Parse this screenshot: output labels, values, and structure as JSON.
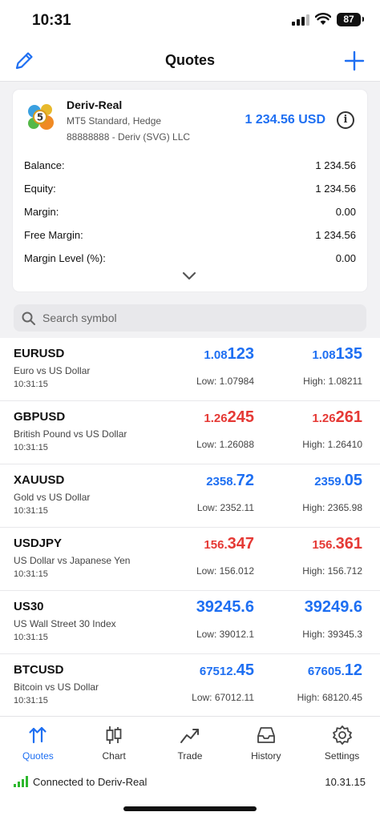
{
  "status_bar": {
    "time": "10:31",
    "battery": "87"
  },
  "nav": {
    "title": "Quotes"
  },
  "account": {
    "name": "Deriv-Real",
    "type": "MT5 Standard, Hedge",
    "login": "88888888 - Deriv (SVG) LLC",
    "balance_display": "1 234.56 USD",
    "info_glyph": "i",
    "rows": [
      {
        "label": "Balance:",
        "value": "1 234.56"
      },
      {
        "label": "Equity:",
        "value": "1 234.56"
      },
      {
        "label": "Margin:",
        "value": "0.00"
      },
      {
        "label": "Free Margin:",
        "value": "1 234.56"
      },
      {
        "label": "Margin Level (%):",
        "value": "0.00"
      }
    ]
  },
  "search": {
    "placeholder": "Search symbol"
  },
  "quotes": [
    {
      "symbol": "EURUSD",
      "desc": "Euro vs US Dollar",
      "time": "10:31:15",
      "bid_small": "1.08",
      "bid_big": "123",
      "ask_small": "1.08",
      "ask_big": "135",
      "direction": "up",
      "low": "Low: 1.07984",
      "high": "High: 1.08211"
    },
    {
      "symbol": "GBPUSD",
      "desc": "British Pound vs US Dollar",
      "time": "10:31:15",
      "bid_small": "1.26",
      "bid_big": "245",
      "ask_small": "1.26",
      "ask_big": "261",
      "direction": "down",
      "low": "Low: 1.26088",
      "high": "High: 1.26410"
    },
    {
      "symbol": "XAUUSD",
      "desc": "Gold vs US Dollar",
      "time": "10:31:15",
      "bid_small": "2358.",
      "bid_big": "72",
      "ask_small": "2359.",
      "ask_big": "05",
      "direction": "up",
      "low": "Low: 2352.11",
      "high": "High: 2365.98"
    },
    {
      "symbol": "USDJPY",
      "desc": "US Dollar vs Japanese Yen",
      "time": "10:31:15",
      "bid_small": "156.",
      "bid_big": "347",
      "ask_small": "156.",
      "ask_big": "361",
      "direction": "down",
      "low": "Low: 156.012",
      "high": "High: 156.712"
    },
    {
      "symbol": "US30",
      "desc": "US Wall Street 30 Index",
      "time": "10:31:15",
      "bid_small": "3924",
      "bid_big": "5.6",
      "ask_small": "3924",
      "ask_big": "9.6",
      "direction": "up",
      "low": "Low: 39012.1",
      "high": "High: 39345.3"
    },
    {
      "symbol": "BTCUSD",
      "desc": "Bitcoin vs US Dollar",
      "time": "10:31:15",
      "bid_small": "67512.",
      "bid_big": "45",
      "ask_small": "67605.",
      "ask_big": "12",
      "direction": "up",
      "low": "Low: 67012.11",
      "high": "High: 68120.45"
    }
  ],
  "tabs": [
    {
      "label": "Quotes",
      "icon": "quotes-icon",
      "active": true
    },
    {
      "label": "Chart",
      "icon": "chart-icon",
      "active": false
    },
    {
      "label": "Trade",
      "icon": "trade-icon",
      "active": false
    },
    {
      "label": "History",
      "icon": "history-icon",
      "active": false
    },
    {
      "label": "Settings",
      "icon": "settings-icon",
      "active": false
    }
  ],
  "connection": {
    "text": "Connected to Deriv-Real",
    "time": "10.31.15"
  },
  "colors": {
    "accent": "#1e6ff2",
    "up": "#1e6ff2",
    "down": "#e53935",
    "connected": "#2eb82e"
  }
}
